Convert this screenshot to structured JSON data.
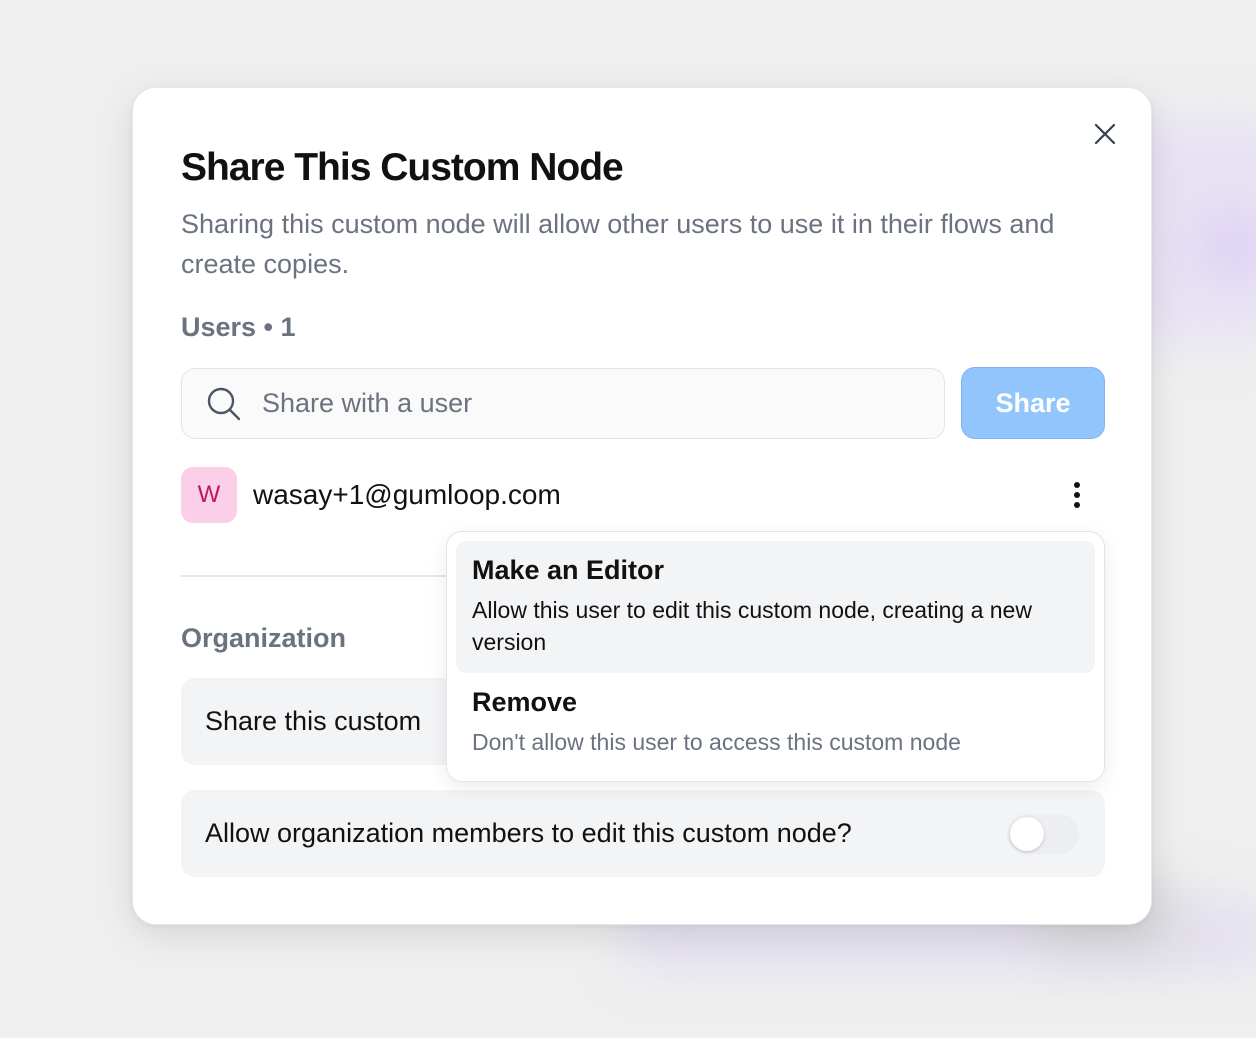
{
  "dialog": {
    "title": "Share This Custom Node",
    "description": "Sharing this custom node will allow other users to use it in their flows and create copies."
  },
  "users": {
    "label": "Users • 1",
    "search_placeholder": "Share with a user",
    "share_label": "Share",
    "list": [
      {
        "avatar_letter": "W",
        "email": "wasay+1@gumloop.com"
      }
    ]
  },
  "organization": {
    "label": "Organization",
    "share_option": "Share this custom",
    "edit_option": "Allow organization members to edit this custom node?",
    "edit_toggle_on": false
  },
  "user_menu": {
    "items": [
      {
        "title": "Make an Editor",
        "description": "Allow this user to edit this custom node, creating a new version"
      },
      {
        "title": "Remove",
        "description": "Don't allow this user to access this custom node"
      }
    ]
  },
  "icons": {
    "close": "close-icon",
    "search": "search-icon",
    "more": "more-vertical-icon"
  },
  "colors": {
    "share_button": "#93c5fd",
    "avatar_bg": "#fbcfe8",
    "avatar_text": "#be185d"
  }
}
